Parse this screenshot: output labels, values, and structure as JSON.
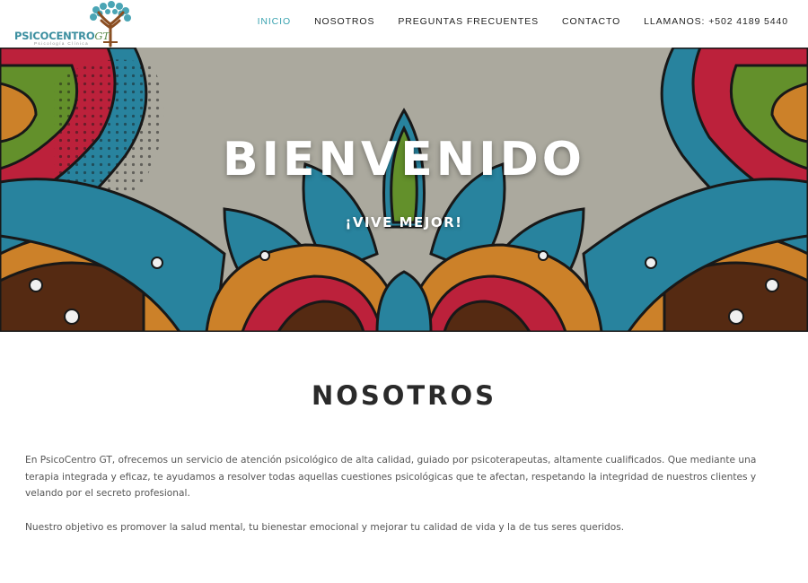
{
  "brand": {
    "name_main": "PSICOCENTRO",
    "name_suffix": "GT",
    "tagline": "Psicología Clínica"
  },
  "nav": {
    "items": [
      {
        "label": "INICIO",
        "active": true
      },
      {
        "label": "NOSOTROS",
        "active": false
      },
      {
        "label": "PREGUNTAS FRECUENTES",
        "active": false
      },
      {
        "label": "CONTACTO",
        "active": false
      },
      {
        "label": "LLAMANOS: +502 4189 5440",
        "active": false
      }
    ]
  },
  "hero": {
    "title": "BIENVENIDO",
    "subtitle": "¡VIVE MEJOR!"
  },
  "about": {
    "title": "NOSOTROS",
    "paragraph1": "En PsicoCentro GT, ofrecemos un servicio de atención psicológico de alta calidad, guiado por psicoterapeutas, altamente cualificados. Que mediante una terapia integrada y eficaz, te ayudamos a resolver  todas aquellas cuestiones psicológicas que te afectan, respetando  la integridad de nuestros clientes y velando por el secreto profesional.",
    "paragraph2": "Nuestro objetivo es promover la salud mental, tu bienestar emocional y mejorar tu calidad de vida y la de tus seres queridos."
  },
  "colors": {
    "accent": "#3aa3b0",
    "teal": "#2b8ca8",
    "crimson": "#c8243f",
    "green": "#6a9a2e",
    "orange": "#d98a2c",
    "brown": "#5b2d14",
    "background_gray": "#b6b4a8"
  }
}
